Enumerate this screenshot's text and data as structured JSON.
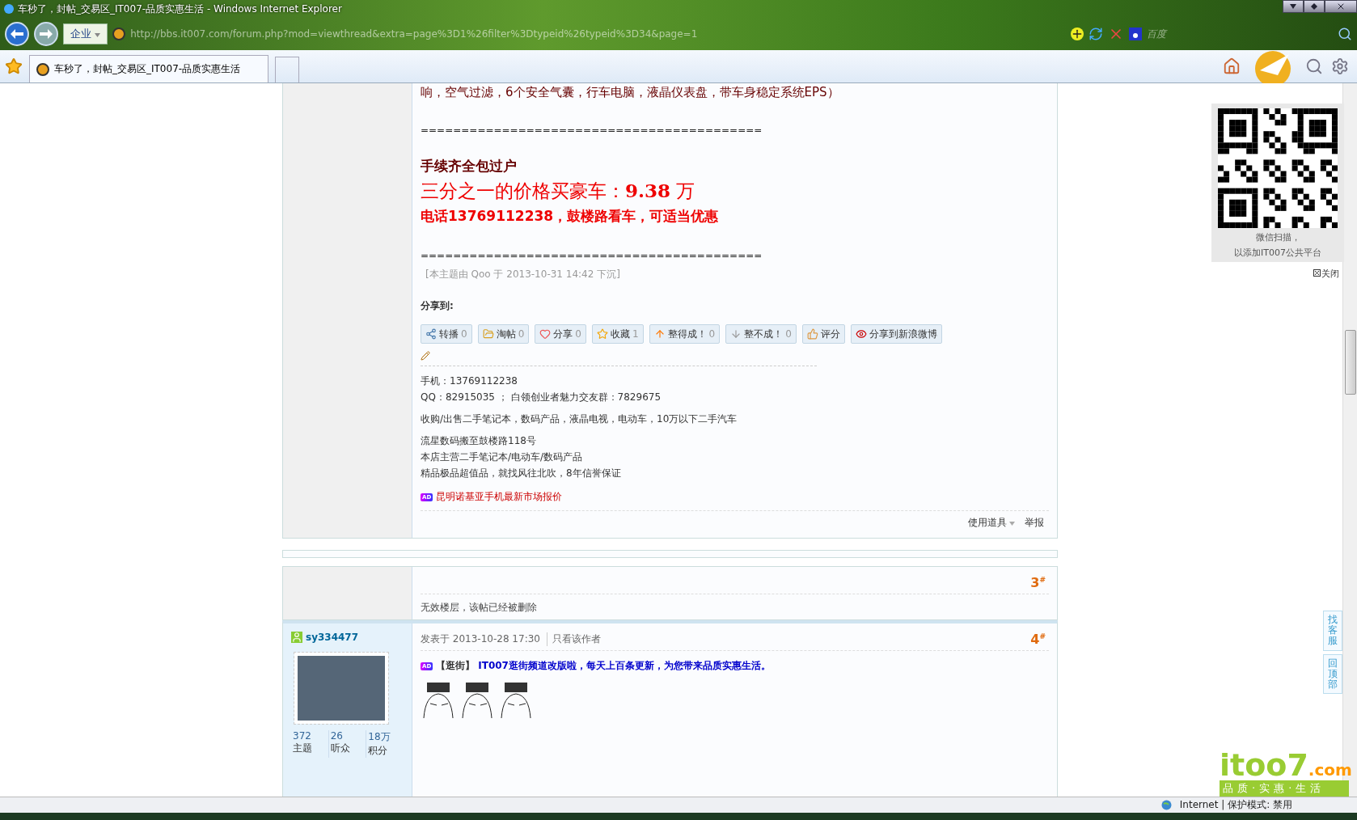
{
  "browser": {
    "title": "车秒了，封帖_交易区_IT007-品质实惠生活 - Windows Internet Explorer",
    "zone": "企业",
    "address": "http://bbs.it007.com/forum.php?mod=viewthread&extra=page%3D1%26filter%3Dtypeid%26typeid%3D34&page=1",
    "search_label": "百度",
    "tab_title": "车秒了，封帖_交易区_IT007-品质实惠生活"
  },
  "post": {
    "lines": [
      {
        "kind": "body",
        "text": "响，空气过滤，6个安全气囊，行车电脑，液晶仪表盘，带车身稳定系统EPS）"
      },
      {
        "kind": "rule",
        "text": "=========================================="
      },
      {
        "kind": "heading",
        "text": "手续齐全包过户"
      },
      {
        "kind": "price",
        "text": "三分之一的价格买豪车：**9.38** 万"
      },
      {
        "kind": "phone",
        "text": "电话13769112238，鼓楼路看车，可适当优惠"
      },
      {
        "kind": "rule",
        "text": "=========================================="
      },
      {
        "kind": "note",
        "text": "[本主题由 Qoo 于 2013-10-31 14:42 下沉]"
      }
    ],
    "share_label": "分享到:",
    "share_buttons": [
      {
        "label": "转播",
        "count": "0"
      },
      {
        "label": "淘帖",
        "count": "0"
      },
      {
        "label": "分享",
        "count": "0"
      },
      {
        "label": "收藏",
        "count": "1"
      },
      {
        "label": "整得成！",
        "count": "0"
      },
      {
        "label": "整不成！",
        "count": "0"
      },
      {
        "label": "评分"
      },
      {
        "label": "分享到新浪微博"
      }
    ],
    "signature": [
      [
        "手机：13769112238",
        "QQ：82915035 ； 白领创业者魅力交友群：7829675"
      ],
      [
        "收购/出售二手笔记本，数码产品，液晶电视，电动车，10万以下二手汽车"
      ],
      [
        "流星数码搬至鼓楼路118号",
        "本店主营二手笔记本/电动车/数码产品",
        "精品极品超值品，就找风往北吹，8年信誉保证"
      ]
    ],
    "ad_badge": "AD",
    "ad_link": "昆明诺基亚手机最新市场报价",
    "actions": [
      "使用道具",
      "举报"
    ]
  },
  "deleted_post": {
    "floor": "3",
    "floor_mark": "#",
    "message": "无效楼层，该帖已经被删除"
  },
  "reply": {
    "username": "sy334477",
    "stats": [
      {
        "value": "372",
        "label": "主题"
      },
      {
        "value": "26",
        "label": "听众"
      },
      {
        "value": "18万",
        "label": "积分"
      }
    ],
    "posted": "发表于 2013-10-28 17:30",
    "author_only": "只看该作者",
    "floor": "4",
    "floor_mark": "#",
    "ad_badge": "AD",
    "ad_tag": "【逛街】",
    "ad_text": "IT007逛街频道改版啦，每天上百条更新，为您带来品质实惠生活。"
  },
  "qr_panel": {
    "caption": [
      "微信扫描，",
      "以添加IT007公共平台"
    ],
    "close": "关闭"
  },
  "side_buttons": [
    "找客服",
    "回顶部"
  ],
  "logo": {
    "brand": "itoo7",
    "domain": ".com",
    "slogan": "品质·实惠·生活"
  },
  "status_bar": {
    "zone": "Internet | 保护模式: 禁用"
  }
}
